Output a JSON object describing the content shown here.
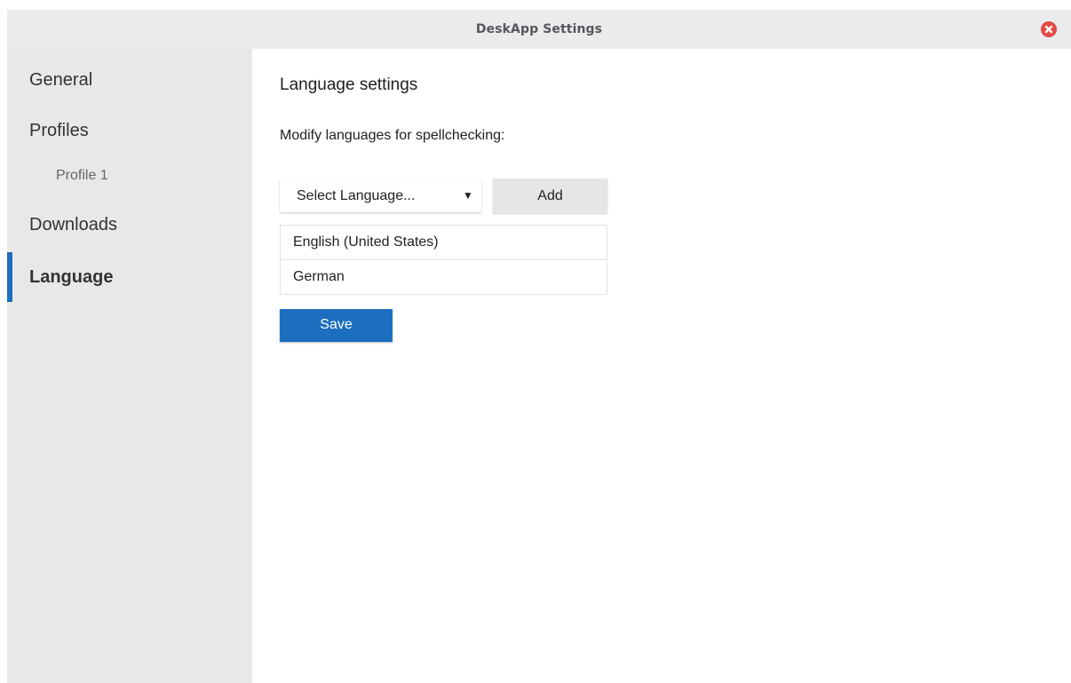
{
  "window": {
    "title": "DeskApp Settings"
  },
  "sidebar": {
    "items": [
      {
        "label": "General"
      },
      {
        "label": "Profiles"
      },
      {
        "label": "Profile 1"
      },
      {
        "label": "Downloads"
      },
      {
        "label": "Language",
        "active": true
      }
    ]
  },
  "main": {
    "heading": "Language settings",
    "subheading": "Modify languages for spellchecking:",
    "select": {
      "value": "Select Language...",
      "caret_icon": "triangle-down-icon"
    },
    "add_label": "Add",
    "languages": [
      "English (United States)",
      "German"
    ],
    "save_label": "Save"
  },
  "colors": {
    "accent": "#1d6fbd",
    "close": "#e34b46",
    "sidebar_bg": "#e8e8e8",
    "titlebar_bg": "#ebebed"
  }
}
